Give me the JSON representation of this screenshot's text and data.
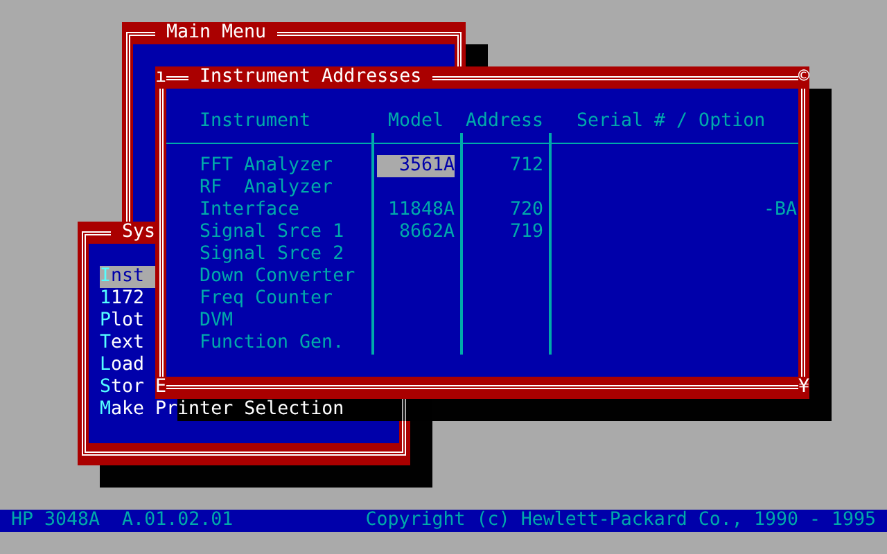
{
  "main_menu": {
    "title": "Main Menu"
  },
  "system_window": {
    "title": "Sys",
    "items": [
      {
        "label": "**I**nst",
        "selected": true
      },
      {
        "label": "**1**172",
        "selected": false
      },
      {
        "label": "**P**lot",
        "selected": false
      },
      {
        "label": "**T**ext",
        "selected": false
      },
      {
        "label": "**L**oad",
        "selected": false
      },
      {
        "label": "**S**tor",
        "selected": false
      },
      {
        "label": "**M**ake Printer Selection",
        "selected": false
      }
    ]
  },
  "instrument_window": {
    "title": "Instrument Addresses",
    "corner_marks": {
      "top_left": "ı",
      "top_right": "©",
      "bottom_left": "E",
      "bottom_right": "¥"
    },
    "columns": [
      "Instrument",
      "Model",
      "Address",
      "Serial # / Option"
    ],
    "rows": [
      {
        "instrument": "FFT Analyzer",
        "model": "3561A",
        "address": "712",
        "selected": true
      },
      {
        "instrument": "RF  Analyzer",
        "selected": false
      },
      {
        "instrument": "Interface",
        "model": "11848A",
        "address": "720",
        "serial": "-BA",
        "selected": false
      },
      {
        "instrument": "Signal Srce 1",
        "model": "8662A",
        "address": "719",
        "selected": false
      },
      {
        "instrument": "Signal Srce 2",
        "selected": false
      },
      {
        "instrument": "Down Converter",
        "selected": false
      },
      {
        "instrument": "Freq Counter",
        "selected": false
      },
      {
        "instrument": "DVM",
        "selected": false
      },
      {
        "instrument": "Function Gen.",
        "selected": false
      }
    ]
  },
  "status_bar": {
    "version": "HP 3048A  A.01.02.01",
    "copyright": "Copyright (c) Hewlett-Packard Co., 1990 - 1995"
  }
}
